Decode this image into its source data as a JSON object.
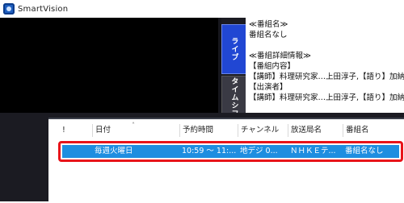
{
  "window": {
    "title": "SmartVision"
  },
  "side_tabs": {
    "live": "ライブ",
    "timeshift": "タイムシフト"
  },
  "program_info": {
    "lines": [
      "≪番組名≫",
      "番組名なし",
      "",
      "≪番組詳細情報≫",
      "【番組内容】",
      "【講師】料理研究家…上田淳子,【語り】加納千秋",
      "【出演者】",
      "【講師】料理研究家…上田淳子,【語り】加納千秋"
    ]
  },
  "reservation_list": {
    "columns": [
      "!",
      "日付",
      "予約時間",
      "チャンネル",
      "放送局名",
      "番組名"
    ],
    "rows": [
      {
        "flag": "",
        "date": "毎週火曜日",
        "time": "10:59 ～ 11:...",
        "channel": "地デジ 0...",
        "station": "ＮＨＫＥテ...",
        "program": "番組名なし"
      }
    ]
  },
  "colors": {
    "live_tab": "#2147d3",
    "selected_row": "#1e8ee0",
    "highlight_border": "#e8141a"
  }
}
